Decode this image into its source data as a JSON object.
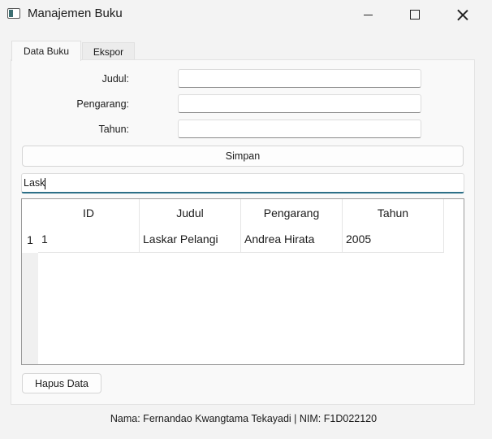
{
  "window": {
    "title": "Manajemen Buku"
  },
  "tabs": [
    {
      "label": "Data Buku",
      "active": true
    },
    {
      "label": "Ekspor",
      "active": false
    }
  ],
  "form": {
    "judul_label": "Judul:",
    "judul_value": "",
    "pengarang_label": "Pengarang:",
    "pengarang_value": "",
    "tahun_label": "Tahun:",
    "tahun_value": "",
    "save_label": "Simpan"
  },
  "search": {
    "value": "Lask"
  },
  "table": {
    "columns": [
      "ID",
      "Judul",
      "Pengarang",
      "Tahun"
    ],
    "rows": [
      {
        "index": "1",
        "cells": [
          "1",
          "Laskar Pelangi",
          "Andrea Hirata",
          "2005"
        ]
      }
    ]
  },
  "delete_label": "Hapus Data",
  "footer": "Nama: Fernandao Kwangtama Tekayadi | NIM: F1D022120",
  "colors": {
    "accent": "#2c6f87",
    "background": "#f3f3f3"
  }
}
